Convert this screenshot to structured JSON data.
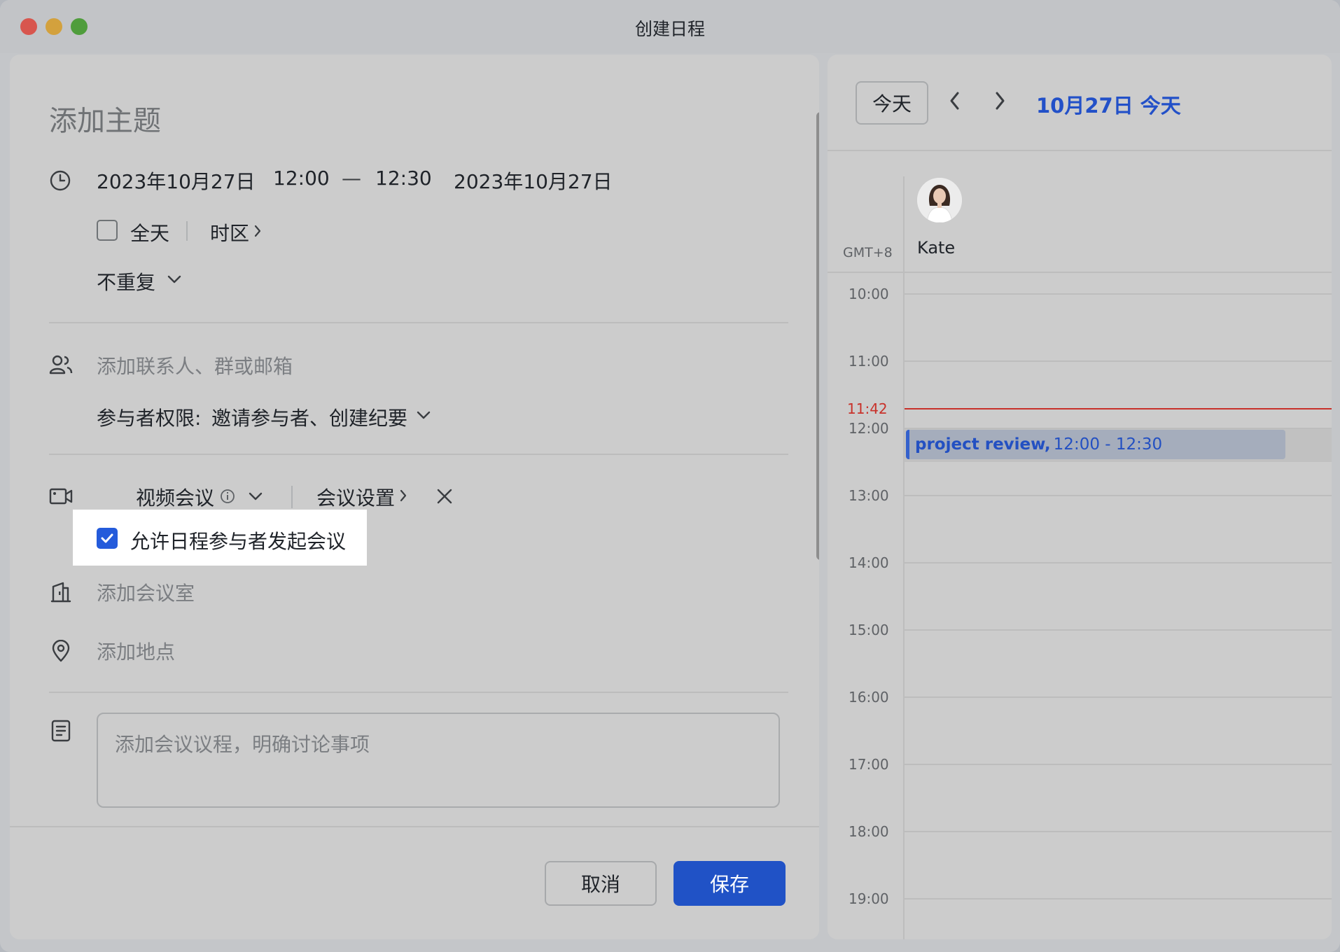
{
  "window": {
    "title": "创建日程"
  },
  "form": {
    "subject_placeholder": "添加主题",
    "start_date": "2023年10月27日",
    "start_time": "12:00",
    "dash": "—",
    "end_time": "12:30",
    "end_date": "2023年10月27日",
    "all_day_label": "全天",
    "timezone_label": "时区",
    "repeat_label": "不重复",
    "attendee_placeholder": "添加联系人、群或邮箱",
    "permission_label": "参与者权限:",
    "permission_value": "邀请参与者、创建纪要",
    "video_meeting_label": "视频会议",
    "meeting_settings_label": "会议设置",
    "allow_start_meeting_label": "允许日程参与者发起会议",
    "allow_start_meeting_checked": true,
    "room_placeholder": "添加会议室",
    "location_placeholder": "添加地点",
    "agenda_placeholder": "添加会议议程，明确讨论事项",
    "cancel_label": "取消",
    "save_label": "保存"
  },
  "calendar": {
    "today_button": "今天",
    "date_title": "10月27日 今天",
    "timezone": "GMT+8",
    "person_name": "Kate",
    "hours": [
      "10:00",
      "11:00",
      "12:00",
      "13:00",
      "14:00",
      "15:00",
      "16:00",
      "17:00",
      "18:00",
      "19:00"
    ],
    "now_time": "11:42",
    "event": {
      "title": "project review,",
      "time_range": "12:00 - 12:30"
    }
  },
  "colors": {
    "accent": "#245bdb",
    "now_line": "#c8312a",
    "event_border": "#3461cc"
  }
}
